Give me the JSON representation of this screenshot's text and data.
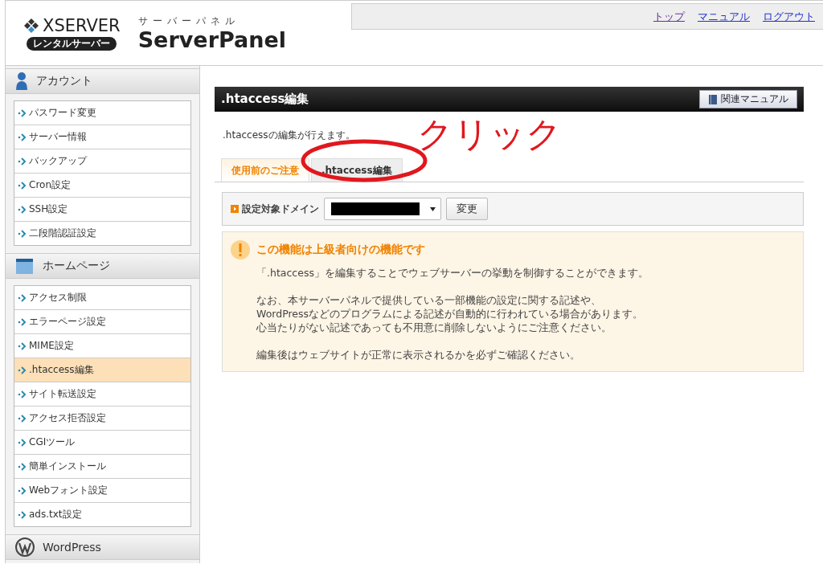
{
  "header": {
    "logo_brand": "XSERVER",
    "logo_badge": "レンタルサーバー",
    "logo_subtitle": "サーバーパネル",
    "logo_title": "ServerPanel",
    "links": [
      {
        "label": "トップ",
        "visited": true
      },
      {
        "label": "マニュアル",
        "visited": false
      },
      {
        "label": "ログアウト",
        "visited": false
      }
    ]
  },
  "sidebar": {
    "sections": [
      {
        "kind": "account",
        "title": "アカウント",
        "items": [
          {
            "label": "パスワード変更",
            "selected": false
          },
          {
            "label": "サーバー情報",
            "selected": false
          },
          {
            "label": "バックアップ",
            "selected": false
          },
          {
            "label": "Cron設定",
            "selected": false
          },
          {
            "label": "SSH設定",
            "selected": false
          },
          {
            "label": "二段階認証設定",
            "selected": false
          }
        ]
      },
      {
        "kind": "homepage",
        "title": "ホームページ",
        "items": [
          {
            "label": "アクセス制限",
            "selected": false
          },
          {
            "label": "エラーページ設定",
            "selected": false
          },
          {
            "label": "MIME設定",
            "selected": false
          },
          {
            "label": ".htaccess編集",
            "selected": true
          },
          {
            "label": "サイト転送設定",
            "selected": false
          },
          {
            "label": "アクセス拒否設定",
            "selected": false
          },
          {
            "label": "CGIツール",
            "selected": false
          },
          {
            "label": "簡単インストール",
            "selected": false
          },
          {
            "label": "Webフォント設定",
            "selected": false
          },
          {
            "label": "ads.txt設定",
            "selected": false
          }
        ]
      },
      {
        "kind": "wordpress",
        "title": "WordPress"
      }
    ]
  },
  "main": {
    "title": ".htaccess編集",
    "manual_button": "関連マニュアル",
    "description": ".htaccessの編集が行えます。",
    "tabs": [
      {
        "label": "使用前のご注意",
        "selected": true
      },
      {
        "label": ".htaccess編集",
        "selected": false
      }
    ],
    "domain": {
      "label": "設定対象ドメイン",
      "button": "変更"
    },
    "notice": {
      "title": "この機能は上級者向けの機能です",
      "paragraphs": [
        {
          "lines": [
            "「.htaccess」を編集することでウェブサーバーの挙動を制御することができます。"
          ]
        },
        {
          "lines": [
            "なお、本サーバーパネルで提供している一部機能の設定に関する記述や、",
            "WordPressなどのプログラムによる記述が自動的に行われている場合があります。",
            "心当たりがない記述であっても不用意に削除しないようにご注意ください。"
          ]
        },
        {
          "lines": [
            "編集後はウェブサイトが正常に表示されるかを必ずご確認ください。"
          ]
        }
      ]
    }
  },
  "annotation": {
    "text": "クリック"
  }
}
